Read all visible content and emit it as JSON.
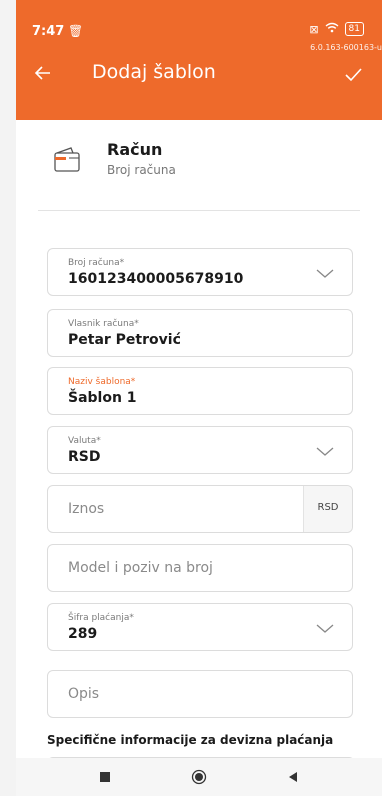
{
  "status_bar": {
    "time": "7:47",
    "battery": "81",
    "build": "6.0.163-600163-u"
  },
  "app_bar": {
    "title": "Dodaj šablon"
  },
  "account": {
    "title": "Račun",
    "subtitle": "Broj računa"
  },
  "fields": {
    "account_number": {
      "label": "Broj računa*",
      "value": "160123400005678910"
    },
    "owner": {
      "label": "Vlasnik računa*",
      "value": "Petar Petrović"
    },
    "template_name": {
      "label": "Naziv šablona*",
      "value": "Šablon 1"
    },
    "currency": {
      "label": "Valuta*",
      "value": "RSD"
    },
    "amount": {
      "placeholder": "Iznos",
      "suffix": "RSD"
    },
    "model": {
      "placeholder": "Model i poziv na broj"
    },
    "payment_code": {
      "label": "Šifra plaćanja*",
      "value": "289"
    },
    "description": {
      "placeholder": "Opis"
    }
  },
  "section": {
    "foreign_title": "Specifične informacije za devizna plaćanja"
  },
  "colors": {
    "brand": "#ee6a2b",
    "border": "#dcdcdc"
  },
  "icons": {
    "back": "arrow-left-icon",
    "confirm": "check-icon",
    "wallet": "wallet-icon",
    "dropdown": "chevron-down-icon"
  }
}
